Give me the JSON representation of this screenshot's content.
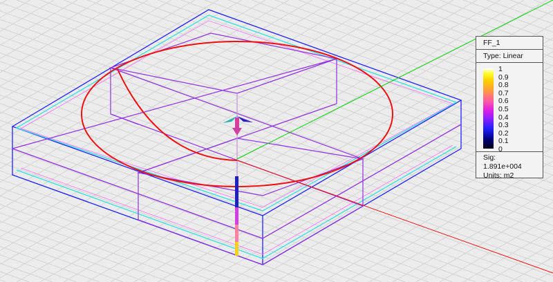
{
  "legend": {
    "title": "FF_1",
    "type": "Type: Linear",
    "ticks": [
      "1",
      "0.9",
      "0.8",
      "0.7",
      "0.6",
      "0.5",
      "0.4",
      "0.3",
      "0.2",
      "0.1",
      "0"
    ],
    "sig": "Sig: 1.891e+004",
    "units": "Units: m2"
  },
  "colors": {
    "outer_box": "#2020ff",
    "inner_box": "#9030e0",
    "cyan_line": "#30e0e0",
    "pattern": "#ff0000",
    "x_axis": "#ff0000",
    "y_axis": "#00cc00",
    "background": "#ececec"
  }
}
